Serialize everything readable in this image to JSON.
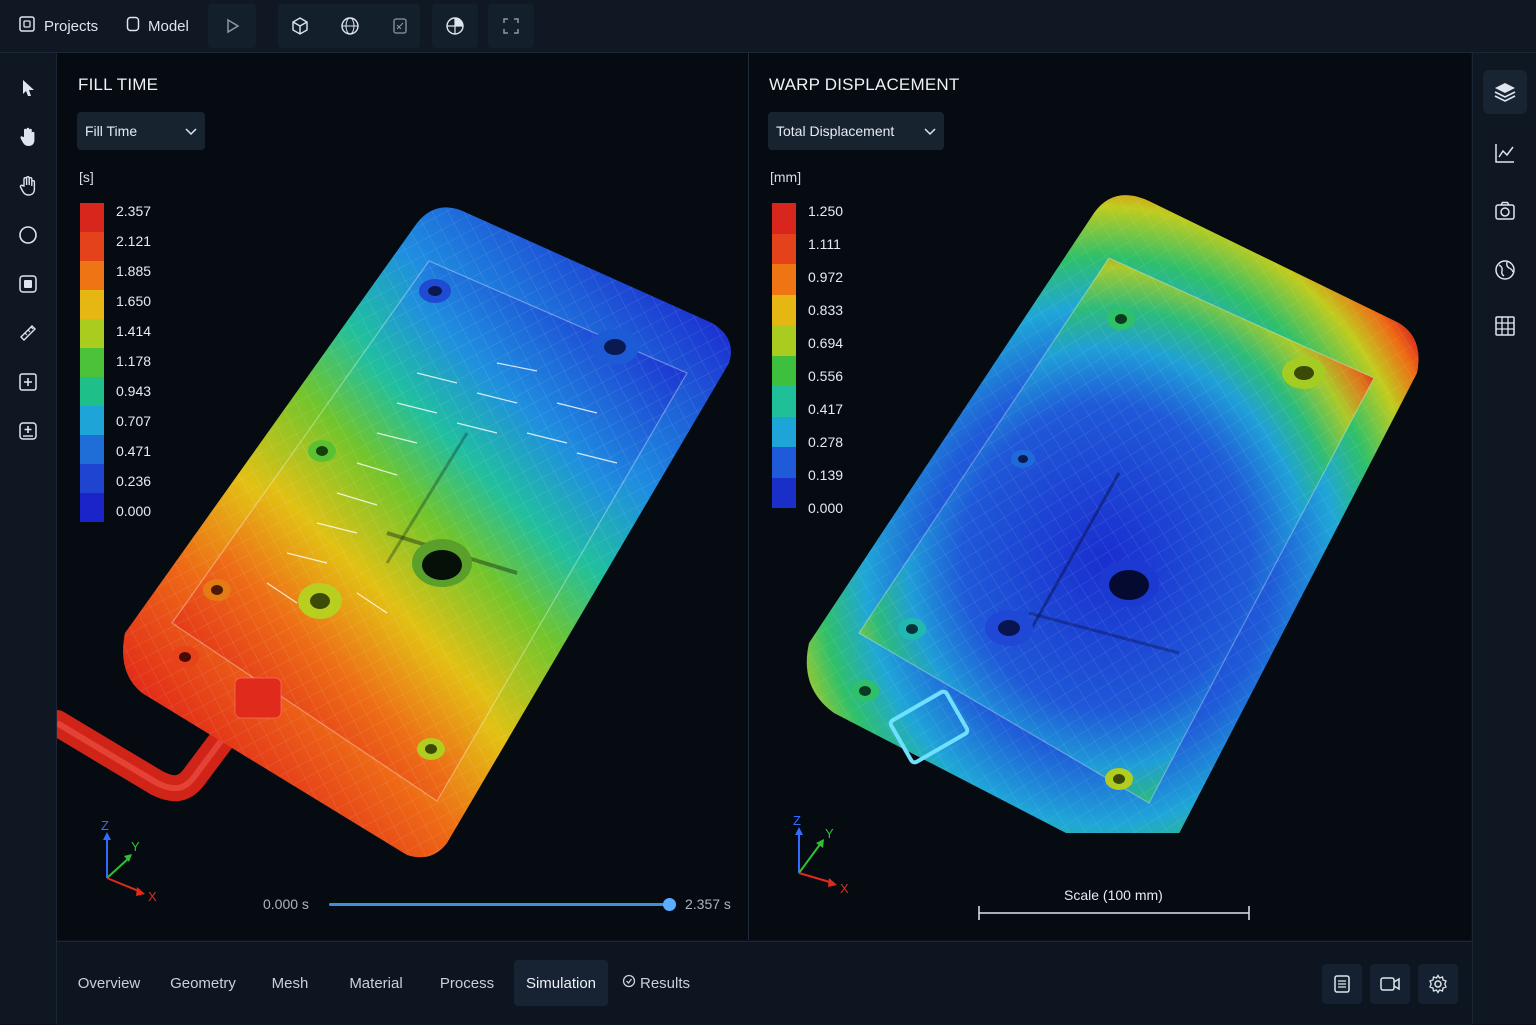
{
  "topbar": {
    "projects_label": "Projects",
    "model_label": "Model",
    "icons": [
      "play-icon",
      "cube-icon",
      "sphere-mesh-icon",
      "rotate-mesh-icon",
      "section-view-icon",
      "fit-view-icon"
    ]
  },
  "left_toolbar": {
    "icons": [
      "select-arrow-icon",
      "hand-pan-icon",
      "hand-grab-icon",
      "orbit-circle-icon",
      "focus-box-icon",
      "measure-ruler-icon",
      "add-frame-icon",
      "add-box-icon"
    ]
  },
  "right_toolbar": {
    "icons": [
      "layers-icon",
      "chart-line-icon",
      "camera-icon",
      "globe-icon",
      "grid-table-icon"
    ]
  },
  "fill_panel": {
    "title": "FILL TIME",
    "dropdown_value": "Fill Time",
    "unit": "[s]",
    "legend_labels": [
      "2.357",
      "2.121",
      "1.885",
      "1.650",
      "1.414",
      "1.178",
      "0.943",
      "0.707",
      "0.471",
      "0.236",
      "0.000"
    ],
    "legend_colors": [
      "#d8261c",
      "#e4421a",
      "#ef7414",
      "#e6b612",
      "#a9cc1e",
      "#4cc23a",
      "#1fbf8a",
      "#1fa4d8",
      "#1f6ed8",
      "#1f44d0",
      "#1a24c8"
    ],
    "axes": {
      "z": "Z",
      "y": "Y",
      "x": "X"
    },
    "timeline": {
      "start": "0.000 s",
      "end": "2.357 s",
      "progress": 1.0
    }
  },
  "warp_panel": {
    "title": "WARP DISPLACEMENT",
    "dropdown_value": "Total Displacement",
    "unit": "[mm]",
    "legend_labels": [
      "1.250",
      "1.111",
      "0.972",
      "0.833",
      "0.694",
      "0.556",
      "0.417",
      "0.278",
      "0.139",
      "0.000"
    ],
    "legend_colors": [
      "#d8261c",
      "#e4421a",
      "#ef7414",
      "#e6b612",
      "#a9cc1e",
      "#3ec03e",
      "#1fbf9a",
      "#1fa4d8",
      "#1f5ad8",
      "#1a2ec8"
    ],
    "axes": {
      "z": "Z",
      "y": "Y",
      "x": "X"
    },
    "scale_label": "Scale (100 mm)"
  },
  "bottom_tabs": {
    "tabs": [
      "Overview",
      "Geometry",
      "Mesh",
      "Material",
      "Process",
      "Simulation",
      "Results"
    ],
    "active": "Simulation",
    "icons": [
      "report-icon",
      "video-icon",
      "settings-gear-icon"
    ]
  }
}
